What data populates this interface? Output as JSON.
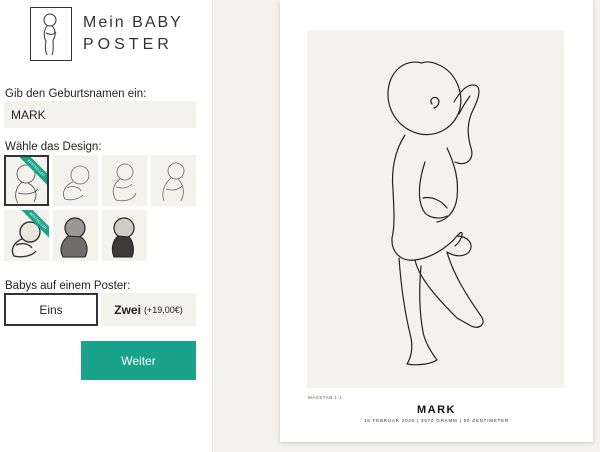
{
  "logo": {
    "line1_a": "Mein",
    "line1_b": "BABY",
    "line2": "POSTER"
  },
  "name_step": {
    "label": "Gib den Geburtsnamen ein:",
    "value": "MARK"
  },
  "design_step": {
    "label": "Wähle das Design:",
    "ribbon_text": "BESTSELLER",
    "tiles": [
      {
        "icon": "baby-line-standing-icon",
        "selected": true,
        "ribbon": true
      },
      {
        "icon": "baby-line-curled-icon",
        "selected": false,
        "ribbon": false
      },
      {
        "icon": "baby-line-sitting-icon",
        "selected": false,
        "ribbon": false
      },
      {
        "icon": "baby-line-side-icon",
        "selected": false,
        "ribbon": false
      },
      {
        "icon": "baby-sketch-curled-icon",
        "selected": false,
        "ribbon": true
      },
      {
        "icon": "baby-sketch-dark-icon",
        "selected": false,
        "ribbon": false
      },
      {
        "icon": "baby-sketch-profile-icon",
        "selected": false,
        "ribbon": false
      }
    ]
  },
  "count_step": {
    "label": "Babys auf einem Poster:",
    "option_one": "Eins",
    "option_two": "Zwei",
    "option_two_price": "(+19,00€)"
  },
  "next_button": "Weiter",
  "poster": {
    "scale": "MASSTAB 1:1",
    "name": "MARK",
    "details": "16 FEBRUAR 2020 | 3570 GRAMM | 50 ZENTIMETER"
  },
  "colors": {
    "accent": "#19a38a",
    "background": "#f4f2ec",
    "border": "#333333"
  }
}
